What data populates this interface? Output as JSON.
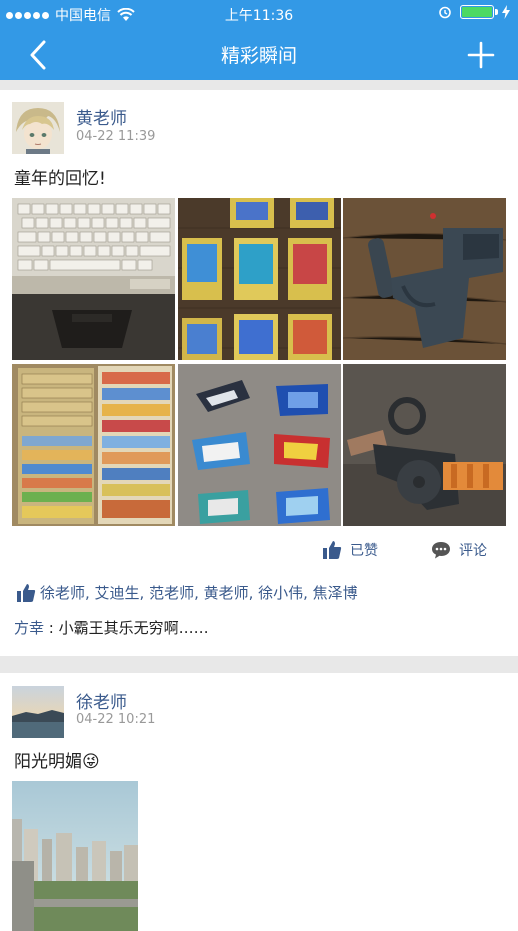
{
  "status_bar": {
    "carrier": "中国电信",
    "time": "上午11:36"
  },
  "nav": {
    "title": "精彩瞬间"
  },
  "posts": [
    {
      "author": "黄老师",
      "time": "04-22 11:39",
      "text": "童年的回忆!",
      "actions": {
        "liked_label": "已赞",
        "comment_label": "评论"
      },
      "likes": "徐老师, 艾迪生, 范老师, 黄老师, 徐小伟, 焦泽博",
      "comments": [
        {
          "author": "方幸",
          "separator": " : ",
          "text": "小霸王其乐无穷啊……"
        }
      ]
    },
    {
      "author": "徐老师",
      "time": "04-22 10:21",
      "text": "阳光明媚",
      "emoji": "😜"
    }
  ],
  "colors": {
    "brand": "#3399e6",
    "link": "#3a5a8c",
    "divider": "#e8e8e8"
  }
}
